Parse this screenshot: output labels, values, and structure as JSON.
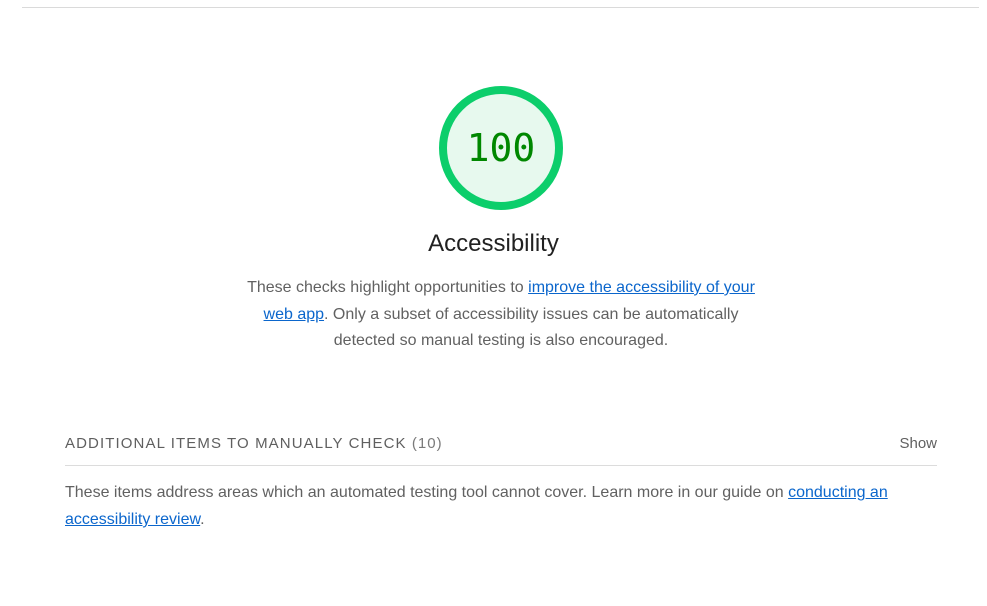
{
  "gauge": {
    "score": "100",
    "ring_color": "#0cce6b",
    "fill_color": "#e7f9ee",
    "text_color": "#008800"
  },
  "category": {
    "title": "Accessibility",
    "description_before": "These checks highlight opportunities to ",
    "description_link": "improve the accessibility of your web app",
    "description_after": ". Only a subset of accessibility issues can be automatically detected so manual testing is also encouraged."
  },
  "manual_section": {
    "title": "ADDITIONAL ITEMS TO MANUALLY CHECK",
    "count": "(10)",
    "toggle_label": "Show",
    "description_before": "These items address areas which an automated testing tool cannot cover. Learn more in our guide on ",
    "description_link": "conducting an accessibility review",
    "description_after": "."
  },
  "colors": {
    "link": "#0b66cc",
    "pass_green": "#0cce6b"
  }
}
